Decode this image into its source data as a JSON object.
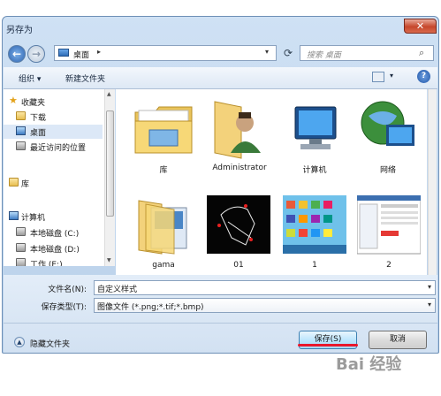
{
  "window": {
    "title": "另存为",
    "close_glyph": "✕"
  },
  "address": {
    "location": "桌面",
    "arrow": "▸",
    "drop": "▾"
  },
  "search": {
    "placeholder": "搜索 桌面"
  },
  "toolbar": {
    "organize": "组织 ▾",
    "new_folder": "新建文件夹",
    "help": "?"
  },
  "sidebar": {
    "items": [
      {
        "label": "收藏夹",
        "icon": "star-icon"
      },
      {
        "label": "下载",
        "icon": "folder-icon"
      },
      {
        "label": "桌面",
        "icon": "desktop-icon"
      },
      {
        "label": "最近访问的位置",
        "icon": "recent-icon"
      },
      {
        "label": "库",
        "icon": "library-icon"
      },
      {
        "label": "计算机",
        "icon": "computer-icon"
      },
      {
        "label": "本地磁盘 (C:)",
        "icon": "drive-icon"
      },
      {
        "label": "本地磁盘 (D:)",
        "icon": "drive-icon"
      },
      {
        "label": "工作 (E:)",
        "icon": "drive-icon"
      }
    ]
  },
  "files": [
    {
      "name": "库",
      "icon": "library-folder-icon"
    },
    {
      "name": "Administrator",
      "icon": "user-folder-icon"
    },
    {
      "name": "计算机",
      "icon": "computer-icon"
    },
    {
      "name": "网络",
      "icon": "network-icon"
    },
    {
      "name": "gama",
      "icon": "folder-icon"
    },
    {
      "name": "01",
      "icon": "image-thumbnail"
    },
    {
      "name": "1",
      "icon": "image-thumbnail"
    },
    {
      "name": "2",
      "icon": "image-thumbnail"
    }
  ],
  "form": {
    "filename_label": "文件名(N):",
    "filename_value": "自定义样式",
    "filetype_label": "保存类型(T):",
    "filetype_value": "图像文件 (*.png;*.tif;*.bmp)"
  },
  "footer": {
    "hide_folders": "隐藏文件夹",
    "save": "保存(S)",
    "cancel": "取消"
  },
  "watermark": "Bai 经验"
}
